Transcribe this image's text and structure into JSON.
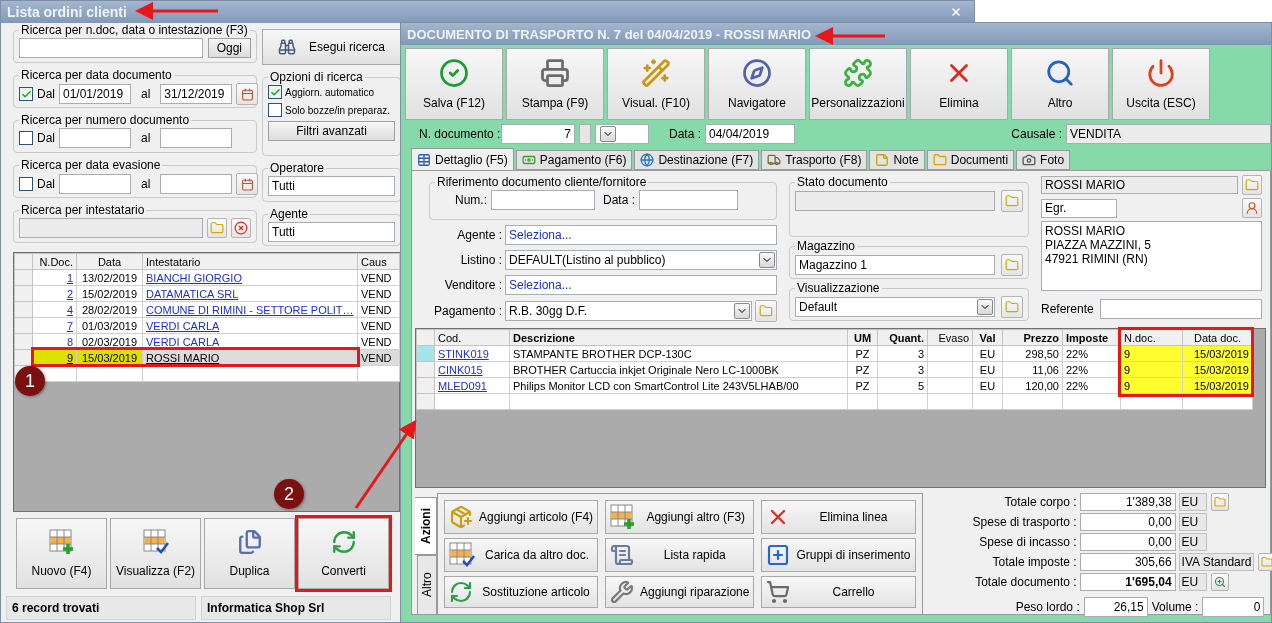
{
  "left_window": {
    "title": "Lista ordini clienti",
    "search": {
      "label": "Ricerca per n.doc, data o intestazione (F3)",
      "button": "Oggi"
    },
    "search_button": "Esegui ricerca",
    "range_filters": [
      {
        "label": "Ricerca per data documento",
        "checked": true,
        "from_label": "Dal",
        "from": "01/01/2019",
        "to_label": "al",
        "to": "31/12/2019"
      },
      {
        "label": "Ricerca per numero documento",
        "checked": false,
        "from_label": "Dal",
        "to_label": "al"
      },
      {
        "label": "Ricerca per data evasione",
        "checked": false,
        "from_label": "Dal",
        "to_label": "al"
      }
    ],
    "holder_filter": {
      "label": "Ricerca per intestatario"
    },
    "options": {
      "label": "Opzioni di ricerca",
      "items": [
        {
          "label": "Aggiorn. automatico",
          "checked": true
        },
        {
          "label": "Solo bozze/in preparaz.",
          "checked": false
        }
      ],
      "button": "Filtri avanzati"
    },
    "selects": [
      {
        "label": "Operatore",
        "value": "Tutti"
      },
      {
        "label": "Agente",
        "value": "Tutti"
      }
    ],
    "table": {
      "columns": [
        "N.Doc.",
        "Data",
        "Intestatario",
        "Caus"
      ],
      "rows": [
        {
          "number": "1",
          "date": "13/02/2019",
          "holder": "BIANCHI GIORGIO",
          "reason": "VEND",
          "selected": false
        },
        {
          "number": "2",
          "date": "15/02/2019",
          "holder": "DATAMATICA SRL",
          "reason": "VEND",
          "selected": false
        },
        {
          "number": "4",
          "date": "28/02/2019",
          "holder": "COMUNE DI RIMINI - SETTORE POLIT…",
          "reason": "VEND",
          "selected": false
        },
        {
          "number": "7",
          "date": "01/03/2019",
          "holder": "VERDI CARLA",
          "reason": "VEND",
          "selected": false
        },
        {
          "number": "8",
          "date": "02/03/2019",
          "holder": "VERDI CARLA",
          "reason": "VEND",
          "selected": false
        },
        {
          "number": "9",
          "date": "15/03/2019",
          "holder": "ROSSI MARIO",
          "reason": "VEND",
          "selected": true
        }
      ]
    },
    "buttons": [
      "Nuovo (F4)",
      "Visualizza (F2)",
      "Duplica",
      "Converti"
    ],
    "status_bar": [
      "6 record trovati",
      "Informatica Shop Srl"
    ]
  },
  "document_window": {
    "title": "DOCUMENTO DI TRASPORTO N. 7 del 04/04/2019 - ROSSI MARIO",
    "toolbar": [
      "Salva (F12)",
      "Stampa (F9)",
      "Visual. (F10)",
      "Navigatore",
      "Personalizzazioni",
      "Elimina",
      "Altro",
      "Uscita (ESC)"
    ],
    "number": {
      "label": "N. documento :",
      "value": "7"
    },
    "date": {
      "label": "Data :",
      "value": "04/04/2019"
    },
    "reason": {
      "label": "Causale :",
      "value": "VENDITA"
    },
    "tabs": [
      {
        "label": "Dettaglio (F5)",
        "selected": true
      },
      {
        "label": "Pagamento (F6)",
        "selected": false
      },
      {
        "label": "Destinazione (F7)",
        "selected": false
      },
      {
        "label": "Trasporto (F8)",
        "selected": false
      },
      {
        "label": "Note",
        "selected": false
      },
      {
        "label": "Documenti",
        "selected": false
      },
      {
        "label": "Foto",
        "selected": false
      }
    ],
    "reference": {
      "label": "Riferimento documento cliente/fornitore",
      "num_label": "Num.:",
      "date_label": "Data :"
    },
    "fields": [
      {
        "label": "Agente :",
        "value": "Seleziona...",
        "kind": "link"
      },
      {
        "label": "Listino :",
        "value": "DEFAULT(Listino al pubblico)",
        "kind": "select"
      },
      {
        "label": "Venditore :",
        "value": "Seleziona...",
        "kind": "link"
      },
      {
        "label": "Pagamento :",
        "value": "R.B. 30gg D.F.",
        "kind": "select-folder"
      }
    ],
    "status": {
      "label": "Stato documento"
    },
    "warehouse": {
      "label": "Magazzino",
      "value": "Magazzino 1"
    },
    "view": {
      "label": "Visualizzazione",
      "value": "Default"
    },
    "customer": {
      "name": "ROSSI MARIO",
      "salutation": "Egr.",
      "address": [
        "ROSSI MARIO",
        "PIAZZA MAZZINI, 5",
        "47921 RIMINI (RN)"
      ],
      "contact_label": "Referente"
    },
    "items": {
      "columns": [
        "Cod.",
        "Descrizione",
        "UM",
        "Quant.",
        "Evaso",
        "Val",
        "Prezzo",
        "Imposte",
        "N.doc.",
        "Data doc."
      ],
      "rows": [
        {
          "code": "STINK019",
          "description": "STAMPANTE BROTHER DCP-130C",
          "unit": "PZ",
          "quantity": "3",
          "currency": "EU",
          "price": "298,50",
          "tax": "22%",
          "doc": "9",
          "doc_date": "15/03/2019",
          "selected": true
        },
        {
          "code": "CINK015",
          "description": "BROTHER Cartuccia inkjet Originale Nero LC-1000BK",
          "unit": "PZ",
          "quantity": "3",
          "currency": "EU",
          "price": "11,06",
          "tax": "22%",
          "doc": "9",
          "doc_date": "15/03/2019",
          "selected": false
        },
        {
          "code": "MLED091",
          "description": "Philips Monitor LCD con SmartControl Lite 243V5LHAB/00",
          "unit": "PZ",
          "quantity": "5",
          "currency": "EU",
          "price": "120,00",
          "tax": "22%",
          "doc": "9",
          "doc_date": "15/03/2019",
          "selected": false
        }
      ]
    },
    "side_tabs": [
      {
        "label": "Azioni",
        "selected": true
      },
      {
        "label": "Altro",
        "selected": false
      }
    ],
    "actions": [
      "Aggiungi articolo (F4)",
      "Aggiungi altro (F3)",
      "Elimina linea",
      "Carica da altro doc.",
      "Lista rapida",
      "Gruppi di inserimento",
      "Sostituzione articolo",
      "Aggiungi riparazione",
      "Carrello"
    ],
    "totals": [
      {
        "label": "Totale corpo :",
        "value": "1'389,38",
        "unit": "EU"
      },
      {
        "label": "Spese di trasporto :",
        "value": "0,00",
        "unit": "EU"
      },
      {
        "label": "Spese di incasso :",
        "value": "0,00",
        "unit": "EU"
      },
      {
        "label": "Totale imposte :",
        "value": "305,66",
        "unit": "IVA Standard"
      },
      {
        "label": "Totale documento :",
        "value": "1'695,04",
        "unit": "EU"
      }
    ],
    "weights": [
      {
        "label": "Peso lordo :",
        "value": "26,15"
      },
      {
        "label": "Volume :",
        "value": "0"
      }
    ]
  },
  "annotations": {
    "badges": [
      "1",
      "2"
    ]
  }
}
